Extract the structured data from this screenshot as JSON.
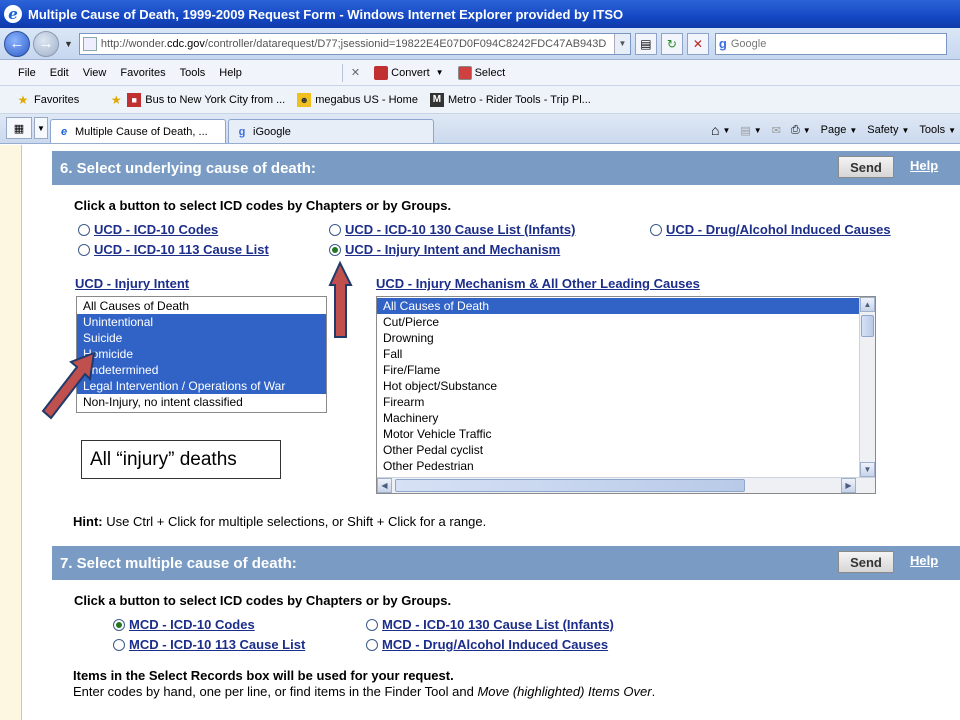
{
  "browser": {
    "title": "Multiple Cause of Death, 1999-2009 Request Form - Windows Internet Explorer provided by ITSO",
    "address_prefix": "http://wonder.",
    "address_host": "cdc.gov",
    "address_path": "/controller/datarequest/D77;jsessionid=19822E4E07D0F094C8242FDC47AB943D",
    "search_placeholder": "Google",
    "menu": [
      "File",
      "Edit",
      "View",
      "Favorites",
      "Tools",
      "Help"
    ],
    "toolbar": {
      "convert": "Convert",
      "select": "Select"
    },
    "favorites_label": "Favorites",
    "favorites": [
      "Bus to New York City from ...",
      "megabus US - Home",
      "Metro - Rider Tools - Trip Pl..."
    ],
    "tabs": [
      "Multiple Cause of Death, ...",
      "iGoogle"
    ],
    "commands": [
      "Page",
      "Safety",
      "Tools"
    ]
  },
  "section6": {
    "title": "6. Select underlying cause of death:",
    "send": "Send",
    "help": "Help",
    "instruction": "Click a button to select ICD codes by Chapters or by Groups.",
    "options": [
      {
        "label": "UCD - ICD-10 Codes",
        "selected": false
      },
      {
        "label": "UCD - ICD-10 130 Cause List (Infants)",
        "selected": false
      },
      {
        "label": "UCD - Drug/Alcohol Induced Causes",
        "selected": false
      },
      {
        "label": "UCD - ICD-10 113 Cause List",
        "selected": false
      },
      {
        "label": "UCD - Injury Intent and Mechanism",
        "selected": true
      }
    ],
    "intent_title": "UCD - Injury Intent",
    "intent_items": [
      {
        "label": "All Causes of Death",
        "selected": false
      },
      {
        "label": "Unintentional",
        "selected": true
      },
      {
        "label": "Suicide",
        "selected": true
      },
      {
        "label": "Homicide",
        "selected": true
      },
      {
        "label": "Undetermined",
        "selected": true
      },
      {
        "label": "Legal Intervention / Operations of War",
        "selected": true
      },
      {
        "label": "Non-Injury, no intent classified",
        "selected": false
      }
    ],
    "mechanism_title": "UCD - Injury Mechanism & All Other Leading Causes",
    "mechanism_items": [
      {
        "label": "All Causes of Death",
        "selected": true
      },
      {
        "label": "Cut/Pierce",
        "selected": false
      },
      {
        "label": "Drowning",
        "selected": false
      },
      {
        "label": "Fall",
        "selected": false
      },
      {
        "label": "Fire/Flame",
        "selected": false
      },
      {
        "label": "Hot object/Substance",
        "selected": false
      },
      {
        "label": "Firearm",
        "selected": false
      },
      {
        "label": "Machinery",
        "selected": false
      },
      {
        "label": "Motor Vehicle Traffic",
        "selected": false
      },
      {
        "label": "Other Pedal cyclist",
        "selected": false
      },
      {
        "label": "Other Pedestrian",
        "selected": false
      }
    ],
    "annotation": "All “injury” deaths",
    "hint_label": "Hint:",
    "hint_text": " Use Ctrl + Click for multiple selections, or Shift + Click for a range."
  },
  "section7": {
    "title": "7. Select multiple cause of death:",
    "send": "Send",
    "help": "Help",
    "instruction": "Click a button to select ICD codes by Chapters or by Groups.",
    "options": [
      {
        "label": "MCD - ICD-10 Codes",
        "selected": true
      },
      {
        "label": "MCD - ICD-10 130 Cause List (Infants)",
        "selected": false
      },
      {
        "label": "MCD - ICD-10 113 Cause List",
        "selected": false
      },
      {
        "label": "MCD - Drug/Alcohol Induced Causes",
        "selected": false
      }
    ],
    "items_note": "Items in the Select Records box will be used for your request.",
    "enter_text_a": "Enter codes by hand, one per line, or find items in the Finder Tool and ",
    "enter_text_em": "Move (highlighted) Items Over",
    "enter_text_b": "."
  },
  "colors": {
    "section_header": "#7a9cc4",
    "selection": "#3163c7",
    "link": "#1c2e8a",
    "arrow_fill": "#c0504d",
    "arrow_stroke": "#1f3a6b"
  }
}
